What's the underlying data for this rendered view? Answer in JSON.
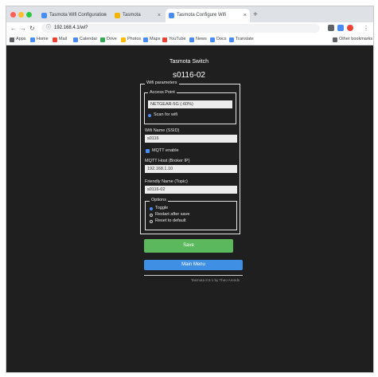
{
  "browser": {
    "tabs": [
      {
        "label": "Tasmota Wifi Configuration",
        "favicon_color": "#4a8cf7"
      },
      {
        "label": "Tasmota",
        "favicon_color": "#f4b400"
      },
      {
        "label": "Tasmota Configure Wifi",
        "favicon_color": "#4a8cf7"
      }
    ],
    "new_tab": "+",
    "tab_close": "×",
    "url": "192.168.4.1/wi?",
    "icons": {
      "back": "←",
      "forward": "→",
      "reload": "↻",
      "lock": "ⓘ",
      "menu": "⋮"
    },
    "bookmarks": [
      {
        "label": "Apps",
        "color": "#5f6368"
      },
      {
        "label": "Home",
        "color": "#4a8cf7"
      },
      {
        "label": "Mail",
        "color": "#ea4335"
      },
      {
        "label": "Calendar",
        "color": "#4a8cf7"
      },
      {
        "label": "Drive",
        "color": "#34a853"
      },
      {
        "label": "Photos",
        "color": "#fbbc05"
      },
      {
        "label": "Maps",
        "color": "#4a8cf7"
      },
      {
        "label": "YouTube",
        "color": "#ea4335"
      },
      {
        "label": "News",
        "color": "#4a8cf7"
      },
      {
        "label": "Docs",
        "color": "#4a8cf7"
      },
      {
        "label": "Translate",
        "color": "#4a8cf7"
      }
    ],
    "other_bookmarks": "Other bookmarks"
  },
  "page": {
    "title": "Tasmota Switch",
    "device": "s0116-02",
    "main_legend": "Wifi parameters",
    "ap1_legend": "Access Point",
    "ap1_value": "NETGEAR-5G (-60%)",
    "ap_link": "Scan for wifi",
    "wifi_name_label": "Wifi Name (SSID)",
    "wifi_name_value": "s0116",
    "mqtt_label": "MQTT enable",
    "mqtt_host_label": "MQTT Host (Broker IP)",
    "mqtt_host_value": "192.168.1.10",
    "friendly_label": "Friendly Name (Topic)",
    "friendly_value": "s0116-02",
    "options_legend": "Options",
    "options": [
      {
        "label": "Toggle",
        "on": true
      },
      {
        "label": "Restart after save",
        "on": false
      },
      {
        "label": "Reset to default",
        "on": false
      }
    ],
    "save_label": "Save",
    "main_menu_label": "Main Menu",
    "footer": "Tasmota 8.5.1 by Theo Arends"
  }
}
